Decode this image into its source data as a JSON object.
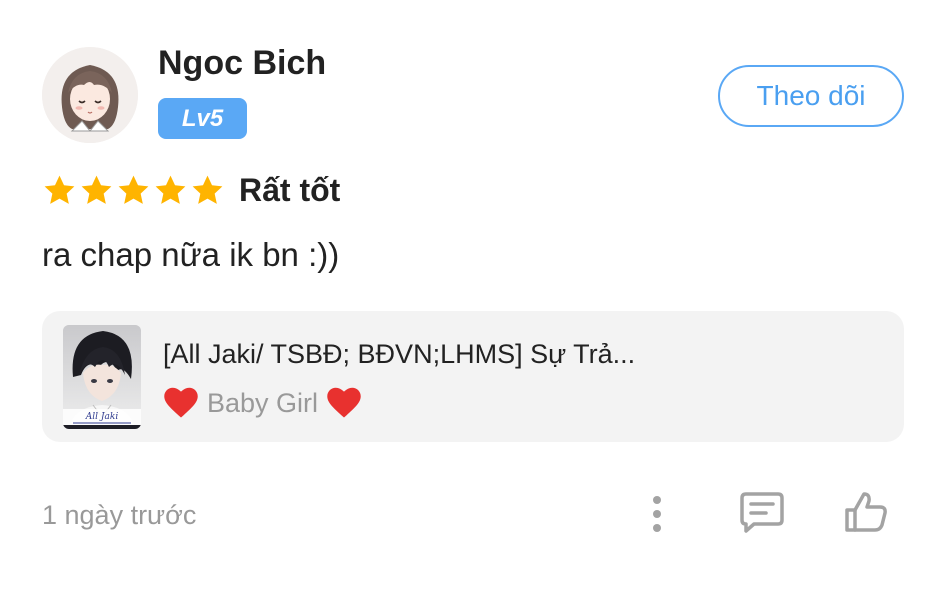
{
  "user": {
    "name": "Ngoc Bich",
    "level": "Lv5",
    "follow_label": "Theo dõi"
  },
  "review": {
    "stars": 5,
    "rating_label": "Rất tốt",
    "comment": "ra chap nữa ik bn :))",
    "timestamp": "1 ngày trước"
  },
  "story": {
    "title": "[All Jaki/ TSBĐ; BĐVN;LHMS] Sự Trả...",
    "author": "Baby Girl",
    "cover_text": "All Jaki"
  },
  "icons": {
    "more": "more-vertical-icon",
    "reply": "comment-icon",
    "like": "thumbs-up-icon"
  },
  "colors": {
    "accent": "#5aa8f5",
    "star": "#ffb400",
    "heart": "#e8312f",
    "muted_text": "#999999",
    "card_bg": "#f3f3f3"
  }
}
